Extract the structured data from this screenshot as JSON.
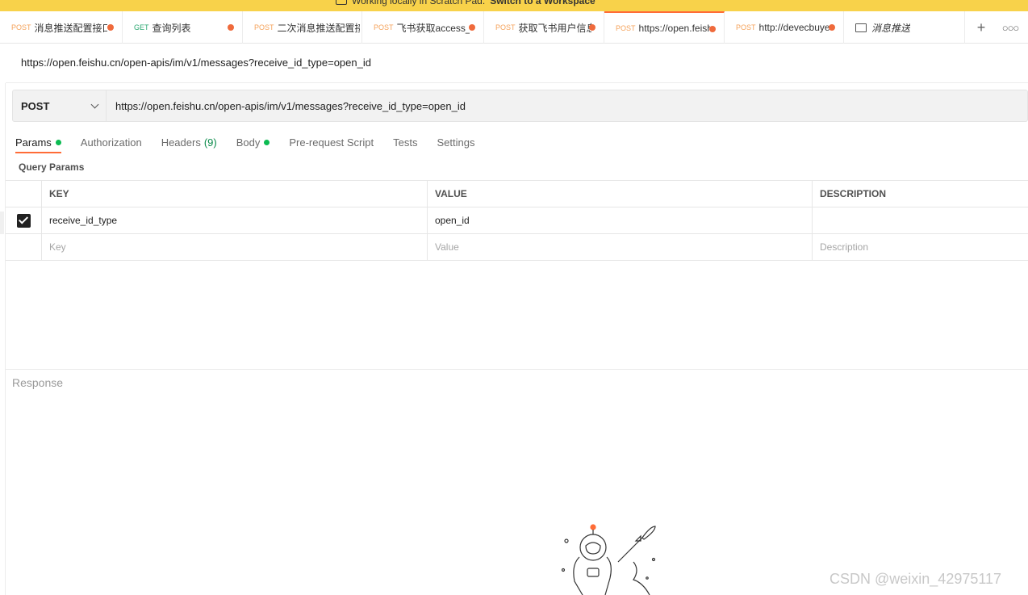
{
  "banner": {
    "text": "Working locally in Scratch Pad.",
    "link": "Switch to a Workspace"
  },
  "tabs": [
    {
      "method": "POST",
      "title": "消息推送配置接口",
      "unsaved": true,
      "active": false
    },
    {
      "method": "GET",
      "title": "查询列表",
      "unsaved": true,
      "active": false
    },
    {
      "method": "POST",
      "title": "二次消息推送配置接口",
      "unsaved": false,
      "active": false
    },
    {
      "method": "POST",
      "title": "飞书获取access_t",
      "unsaved": true,
      "active": false
    },
    {
      "method": "POST",
      "title": "获取飞书用户信息",
      "unsaved": true,
      "active": false
    },
    {
      "method": "POST",
      "title": "https://open.feishu",
      "unsaved": true,
      "active": true
    },
    {
      "method": "POST",
      "title": "http://devecbuyer",
      "unsaved": true,
      "active": false
    }
  ],
  "folder_tab": {
    "title": "消息推送"
  },
  "request": {
    "title": "https://open.feishu.cn/open-apis/im/v1/messages?receive_id_type=open_id",
    "method": "POST",
    "url": "https://open.feishu.cn/open-apis/im/v1/messages?receive_id_type=open_id"
  },
  "subtabs": {
    "params": "Params",
    "authorization": "Authorization",
    "headers": "Headers",
    "headers_count": "(9)",
    "body": "Body",
    "prerequest": "Pre-request Script",
    "tests": "Tests",
    "settings": "Settings"
  },
  "query_params": {
    "title": "Query Params",
    "columns": {
      "key": "KEY",
      "value": "VALUE",
      "description": "DESCRIPTION"
    },
    "rows": [
      {
        "checked": true,
        "key": "receive_id_type",
        "value": "open_id",
        "description": ""
      }
    ],
    "placeholders": {
      "key": "Key",
      "value": "Value",
      "description": "Description"
    }
  },
  "response": {
    "label": "Response"
  },
  "watermark": "CSDN @weixin_42975117",
  "colors": {
    "accent": "#ff6c37",
    "unsaved_dot": "#ef6a3c",
    "active_dot": "#0cbb52",
    "banner": "#f8d24a"
  }
}
